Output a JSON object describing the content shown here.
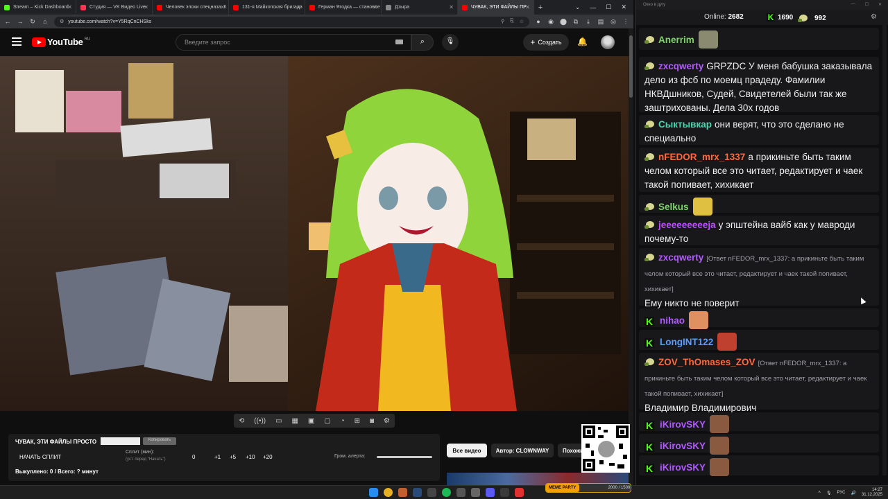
{
  "browser": {
    "tabs": [
      {
        "label": "Stream – Kick Dashboard",
        "color": "#53fc18"
      },
      {
        "label": "Студия — VK Видео Live",
        "color": "#ff3355"
      },
      {
        "label": "Человек эпохи спецназа. К",
        "color": "#ff0000"
      },
      {
        "label": "131-я Майкопская бригада",
        "color": "#ff0000"
      },
      {
        "label": "Герман Ягодка — становле",
        "color": "#ff0000"
      },
      {
        "label": "Дзыра",
        "color": "#888888"
      },
      {
        "label": "ЧУВАК, ЭТИ ФАЙЛЫ ПР",
        "color": "#ff0000",
        "active": true
      }
    ],
    "new_tab": "+",
    "url": "youtube.com/watch?v=Y5RqCnCHSks"
  },
  "youtube": {
    "logo": "YouTube",
    "logo_region": "RU",
    "search_placeholder": "Введите запрос",
    "create_label": "Создать",
    "chips": {
      "all": "Все видео",
      "author": "Автор: CLOWNWAY",
      "similar": "Похожие"
    }
  },
  "panel": {
    "title": "ЧУВАК, ЭТИ ФАЙЛЫ ПРОСТО",
    "copy_btn": "Копировать",
    "start_split": "НАЧАТЬ СПЛИТ",
    "split_label": "Сплит (мин):",
    "split_sub": "(уст. перед \"Начать\")",
    "split_buttons": [
      "0",
      "+1",
      "+5",
      "+10",
      "+20"
    ],
    "alert_label": "Гром. алерта:",
    "spent": "Выкуплено: 0 / Всего: ? минут"
  },
  "overlay_badge": {
    "label": "MEME PARTY",
    "value": "2000 / 1500"
  },
  "taskbar": {
    "lang": "РУС",
    "time": "14:27",
    "date": "31.12.2025"
  },
  "chat": {
    "window_title": "Окно в дугу",
    "online_label": "Online:",
    "online_count": "2682",
    "kick_count": "1690",
    "bot_count": "992",
    "messages": [
      {
        "platform": "bot",
        "nick": "Anerrim",
        "color": "#7fd36a",
        "text": "",
        "emote": true,
        "emote_color": "#8a8a70"
      },
      {
        "platform": "bot",
        "nick": "zxcqwerty",
        "color": "#b15aff",
        "text": "GRPZDC У меня бабушка заказывала дело из фсб по моемц прадеду. Фамилии НКВДшников, Судей, Свидетелей были так же заштрихованы. Дела 30х годов"
      },
      {
        "platform": "bot",
        "nick": "Сыктывкар",
        "color": "#4ad8b0",
        "text": "они верят, что это сделано не специально"
      },
      {
        "platform": "bot",
        "nick": "nFEDOR_mrx_1337",
        "color": "#ff6a3d",
        "text": "а прикиньте быть таким челом который все это читает, редактирует и чаек такой попивает, хихикает"
      },
      {
        "platform": "bot",
        "nick": "Selkus",
        "color": "#7fd36a",
        "text": "",
        "emote": true,
        "emote_color": "#e0c040"
      },
      {
        "platform": "bot",
        "nick": "jeeeeeeeeeja",
        "color": "#c04dff",
        "text": "у эпштейна вайб как у мавроди почему-то"
      },
      {
        "platform": "bot",
        "nick": "zxcqwerty",
        "color": "#b15aff",
        "reply": "[Ответ nFEDOR_mrx_1337: а прикиньте быть таким челом который все это читает, редактирует и чаек такой попивает, хихикает]",
        "text": "Ему никто не поверит"
      },
      {
        "platform": "kick",
        "nick": "nihao",
        "color": "#b15aff",
        "text": "",
        "emote": true,
        "emote_color": "#e09060"
      },
      {
        "platform": "kick",
        "nick": "LongINT122",
        "color": "#5a9cff",
        "text": "",
        "emote": true,
        "emote_color": "#c04030"
      },
      {
        "platform": "bot",
        "nick": "ZOV_ThOmases_ZOV",
        "color": "#ff6a3d",
        "reply": "[Ответ nFEDOR_mrx_1337: а прикиньте быть таким челом который все это читает, редактирует и чаек такой попивает, хихикает]",
        "text": "Владимир Владимирович"
      },
      {
        "platform": "kick",
        "nick": "iKirovSKY",
        "color": "#b15aff",
        "text": "",
        "emote": true,
        "emote_color": "#8a5a40"
      },
      {
        "platform": "kick",
        "nick": "iKirovSKY",
        "color": "#b15aff",
        "text": "",
        "emote": true,
        "emote_color": "#8a5a40"
      },
      {
        "platform": "kick",
        "nick": "iKirovSKY",
        "color": "#b15aff",
        "text": "",
        "emote": true,
        "emote_color": "#8a5a40"
      }
    ]
  }
}
